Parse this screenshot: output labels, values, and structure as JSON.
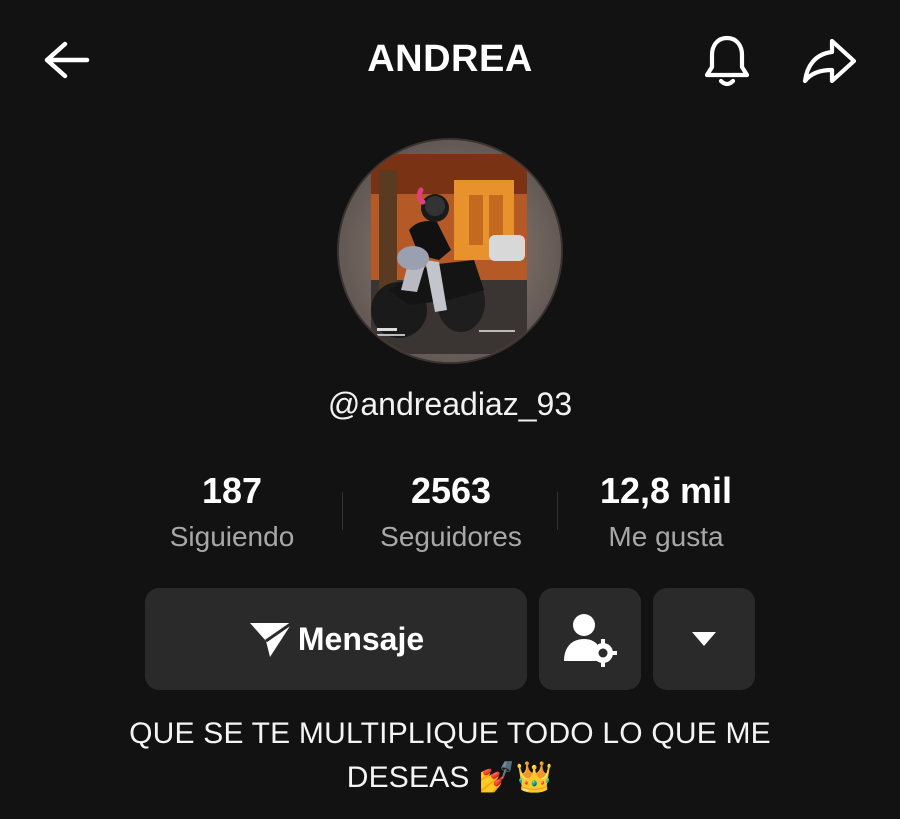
{
  "header": {
    "title": "ANDREA",
    "back_icon": "arrow-left-icon",
    "notification_icon": "bell-icon",
    "share_icon": "share-arrow-icon"
  },
  "profile": {
    "username": "@andreadiaz_93",
    "avatar_alt": "profile-photo"
  },
  "stats": [
    {
      "value": "187",
      "label": "Siguiendo"
    },
    {
      "value": "2563",
      "label": "Seguidores"
    },
    {
      "value": "12,8 mil",
      "label": "Me gusta"
    }
  ],
  "actions": {
    "message_label": "Mensaje",
    "message_icon": "paper-plane-icon",
    "friend_settings_icon": "user-gear-icon",
    "more_icon": "caret-down-icon"
  },
  "bio": {
    "text": "QUE SE TE MULTIPLIQUE TODO LO QUE ME DESEAS 💅👑"
  },
  "colors": {
    "background": "#121212",
    "button": "#2a2a2a",
    "secondary_text": "#a8a8a8"
  }
}
